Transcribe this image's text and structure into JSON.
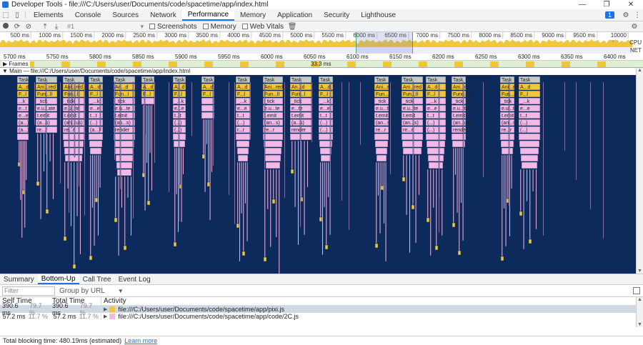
{
  "window": {
    "title": "Developer Tools - file:///C:/Users/user/Documents/code/spacetime/app/index.html",
    "controls": [
      "—",
      "❐",
      "✕"
    ]
  },
  "tabs": [
    "Elements",
    "Console",
    "Sources",
    "Network",
    "Performance",
    "Memory",
    "Application",
    "Security",
    "Lighthouse"
  ],
  "active_tab": "Performance",
  "issues_badge": "1",
  "toolbar": {
    "recording_select": "#1",
    "screenshots_label": "Screenshots",
    "memory_label": "Memory",
    "webvitals_label": "Web Vitals"
  },
  "overview": {
    "ticks": [
      "500 ms",
      "1000 ms",
      "1500 ms",
      "2000 ms",
      "2500 ms",
      "3000 ms",
      "3500 ms",
      "4000 ms",
      "4500 ms",
      "5000 ms",
      "5500 ms",
      "6000 ms",
      "6500 ms",
      "7000 ms",
      "7500 ms",
      "8000 ms",
      "8500 ms",
      "9000 ms",
      "9500 ms",
      "10000 ms"
    ],
    "cpu_label": "CPU",
    "net_label": "NET"
  },
  "ruler": [
    "5700 ms",
    "5750 ms",
    "5800 ms",
    "5850 ms",
    "5900 ms",
    "5950 ms",
    "6000 ms",
    "6050 ms",
    "6100 ms",
    "6150 ms",
    "6200 ms",
    "6250 ms",
    "6300 ms",
    "6350 ms",
    "6400 ms"
  ],
  "frames": {
    "label": "Frames",
    "duration": "33.3 ms"
  },
  "main_thread": {
    "label": "Main — file:///C:/Users/user/Documents/code/spacetime/app/index.html"
  },
  "flame": {
    "colors": {
      "task": "#c8c8c8",
      "yellow": "#f0c63a",
      "pink": "#f2b8e6",
      "bg": "#0d2a5c"
    },
    "columns": [
      {
        "labels": [
          "Task",
          "A...d",
          "F...l",
          "...k",
          "e...t",
          "e...e",
          "(a...)",
          "(a...)"
        ],
        "depth": 9
      },
      {
        "labels": [
          "Task",
          "Ani...red",
          "Fun...ll",
          "_tick",
          "e.u...ate",
          "t.emit",
          "(a...s)",
          "re...r"
        ],
        "depth": 8
      },
      {
        "labels": [
          "Task",
          "Ani...red",
          "Fun...ll",
          "_tick",
          "e.u...te",
          "t.emit",
          "(an...us)",
          "re...r"
        ],
        "depth": 12
      },
      {
        "labels": [
          "Task",
          "A...d",
          "F...l",
          "_...k",
          "e...e",
          "t...t",
          "(...)",
          "(a...)"
        ],
        "depth": 11
      },
      {
        "labels": [
          "Task",
          "An...d",
          "Fun...l",
          "_tick",
          "e.u...te",
          "t.emit",
          "(an...s)",
          "render"
        ],
        "depth": 14
      },
      {
        "labels": [
          "Task",
          "A...d",
          "F...l"
        ],
        "depth": 4
      },
      {
        "labels": [
          "Task",
          "A...d",
          "F...l",
          "_...k",
          "e...e",
          "t...t",
          "(...)",
          "(...)"
        ],
        "depth": 10
      },
      {
        "labels": [
          "Task",
          "A...d",
          "F...l"
        ],
        "depth": 6
      },
      {
        "labels": [
          "Task",
          "A...d",
          "F...l",
          "_...k",
          "e...e",
          "t...t",
          "(...)",
          "r...r"
        ],
        "depth": 12
      },
      {
        "labels": [
          "Task",
          "Ani...red",
          "Fun...ll",
          "_tick",
          "e.u...te",
          "t.emit",
          "(an...s)",
          "re...r"
        ],
        "depth": 13
      },
      {
        "labels": [
          "Task",
          "An...d",
          "Fun...l",
          "_tick",
          "e...te",
          "t.emit",
          "(a...s)",
          "render"
        ],
        "depth": 9
      },
      {
        "labels": [
          "Task",
          "A...d",
          "F...l",
          "_...k",
          "e...e",
          "t...t",
          "(...)",
          "(...)"
        ],
        "depth": 12
      },
      {
        "labels": [
          "Task",
          "Ani...red",
          "Fun...ll",
          "_tick",
          "e.u...te",
          "t.emit",
          "(an...s)",
          "re...r"
        ],
        "depth": 12
      },
      {
        "labels": [
          "Task",
          "Ani...red",
          "Fun...ll",
          "_tick",
          "e.u...te",
          "t.emit",
          "(an...s)",
          "re...r"
        ],
        "depth": 11
      },
      {
        "labels": [
          "Task",
          "A...d",
          "F...l",
          "_...k",
          "e...e",
          "t...t",
          "(...)",
          "(...)"
        ],
        "depth": 13
      },
      {
        "labels": [
          "Task",
          "Ani...red",
          "Func...all",
          "_tick",
          "e.u...te",
          "t.emit",
          "(an...us)",
          "render"
        ],
        "depth": 10
      },
      {
        "labels": [
          "Task",
          "Ani...red",
          "Fun...ll",
          "_tick",
          "e.u...te",
          "t.emit",
          "(an...s)",
          "re...r"
        ],
        "depth": 11
      },
      {
        "labels": [
          "Task",
          "A...d",
          "F...l",
          "_...k",
          "e...e",
          "t...t",
          "(...)",
          "(...)"
        ],
        "depth": 13
      }
    ]
  },
  "bottom_tabs": [
    "Summary",
    "Bottom-Up",
    "Call Tree",
    "Event Log"
  ],
  "active_bottom_tab": "Bottom-Up",
  "filter": {
    "placeholder": "Filter",
    "group_by": "Group by URL"
  },
  "table": {
    "headers": [
      "Self Time",
      "Total Time",
      "Activity"
    ],
    "rows": [
      {
        "self": "390.6 ms",
        "self_pct": "79.7 %",
        "total": "390.6 ms",
        "total_pct": "79.7 %",
        "activity": "file:///C:/Users/user/Documents/code/spacetime/app/pixi.js",
        "color": "#f0c63a"
      },
      {
        "self": "57.2 ms",
        "self_pct": "11.7 %",
        "total": "57.2 ms",
        "total_pct": "11.7 %",
        "activity": "file:///C:/Users/user/Documents/code/spacetime/app/code/2C.js",
        "color": "#f2b8e6"
      }
    ]
  },
  "status": {
    "text": "Total blocking time: 480.19ms (estimated)",
    "link": "Learn more"
  }
}
